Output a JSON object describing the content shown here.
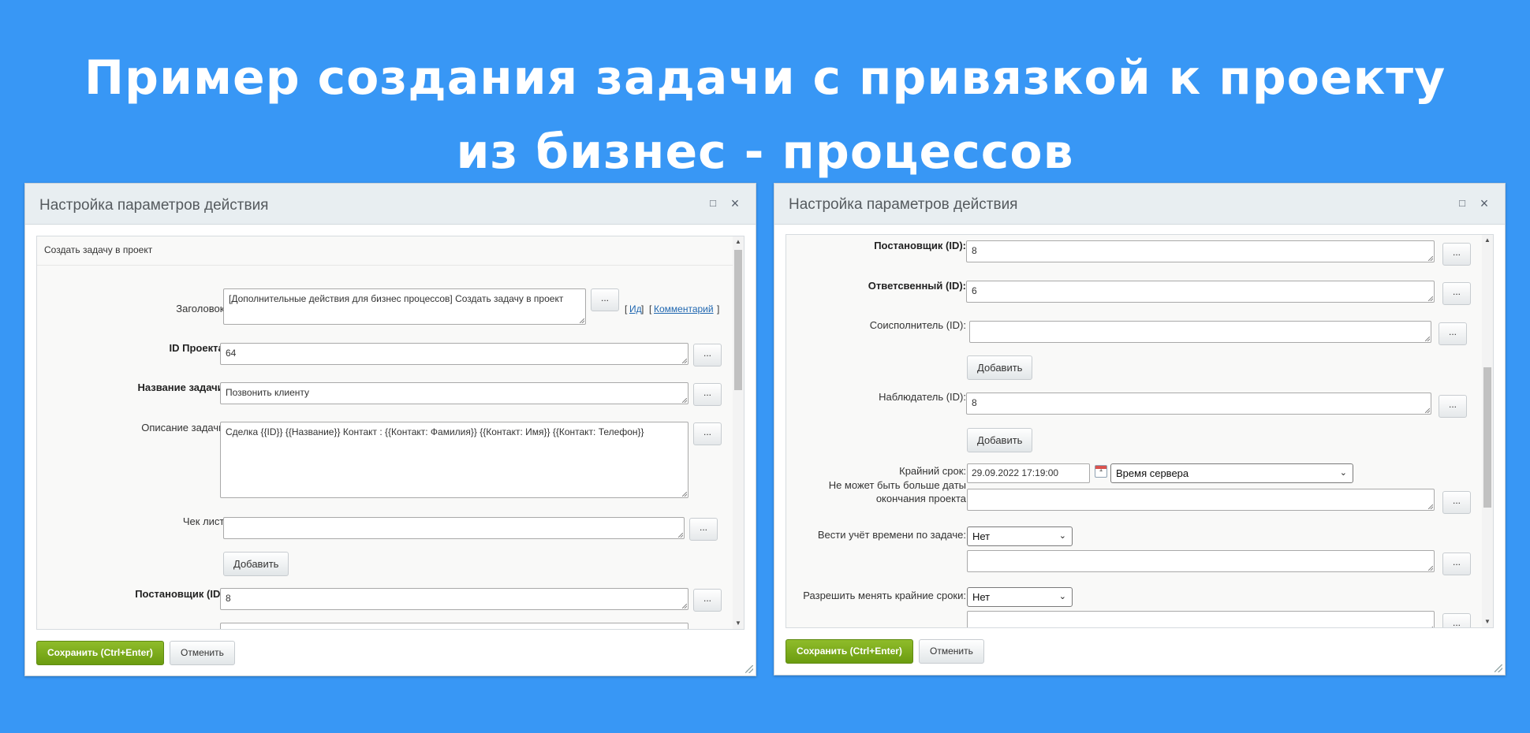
{
  "banner": {
    "line1": "Пример создания задачи с привязкой к проекту",
    "line2": "из бизнес - процессов"
  },
  "dialog_title": "Настройка параметров действия",
  "footer": {
    "save_label": "Сохранить (Ctrl+Enter)",
    "cancel_label": "Отменить"
  },
  "dots_label": "...",
  "left": {
    "section_title": "Создать задачу в проект",
    "title_label": "Заголовок:",
    "title_value": "[Дополнительные действия для бизнес процессов] Создать задачу в проект",
    "id_link": "Ид",
    "comment_link": "Комментарий",
    "project_id_label": "ID Проекта:",
    "project_id_value": "64",
    "task_name_label": "Название задачи:",
    "task_name_value": "Позвонить клиенту",
    "description_label": "Описание задачи:",
    "description_value": "Сделка {{ID}} {{Название}} Контакт : {{Контакт: Фамилия}} {{Контакт: Имя}}  {{Контакт: Телефон}}",
    "checklist_label": "Чек лист:",
    "checklist_value": "",
    "add_label": "Добавить",
    "creator_label": "Постановщик (ID):",
    "creator_value": "8"
  },
  "right": {
    "creator_label": "Постановщик (ID):",
    "creator_value": "8",
    "responsible_label": "Ответсвенный (ID):",
    "responsible_value": "6",
    "coexecutor_label": "Соисполнитель (ID):",
    "coexecutor_value": "",
    "add_label": "Добавить",
    "observer_label": "Наблюдатель (ID):",
    "observer_value": "8",
    "deadline_label": "Крайний срок:",
    "deadline_note_1": "Не может быть больше даты",
    "deadline_note_2": "окончания проекта",
    "deadline_value": "29.09.2022 17:19:00",
    "timezone_value": "Время сервера",
    "time_tracking_label": "Вести учёт времени по задаче:",
    "time_tracking_value": "Нет",
    "allow_change_deadline_label": "Разрешить менять крайние сроки:",
    "allow_change_deadline_value": "Нет"
  }
}
